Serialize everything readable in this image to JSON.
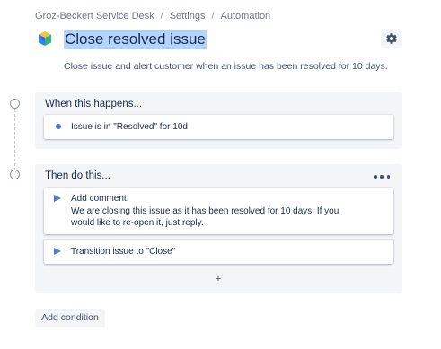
{
  "breadcrumb": {
    "items": [
      "Groz-Beckert Service Desk",
      "Settings",
      "Automation"
    ],
    "separator": "/"
  },
  "header": {
    "title": "Close resolved issue",
    "description": "Close issue and alert customer when an issue has been resolved for 10 days.",
    "logo_icon": "project-cube-logo",
    "settings_icon": "gear-icon"
  },
  "when_section": {
    "title": "When this happens...",
    "triggers": [
      {
        "label": "Issue is in \"Resolved\" for 10d"
      }
    ]
  },
  "then_section": {
    "title": "Then do this...",
    "more_icon": "more-horizontal-icon",
    "actions": [
      {
        "label": "Add comment:",
        "detail": "We are closing this issue as it has been resolved for 10 days. If you would like to re-open it, just reply."
      },
      {
        "label": "Transition issue to \"Close\""
      }
    ],
    "add_label": "+"
  },
  "footer": {
    "add_condition_label": "Add condition"
  },
  "colors": {
    "accent": "#4a7bd0",
    "panel_bg": "#f4f5f7",
    "title_highlight": "#b3d4fc",
    "text": "#172b4d"
  }
}
